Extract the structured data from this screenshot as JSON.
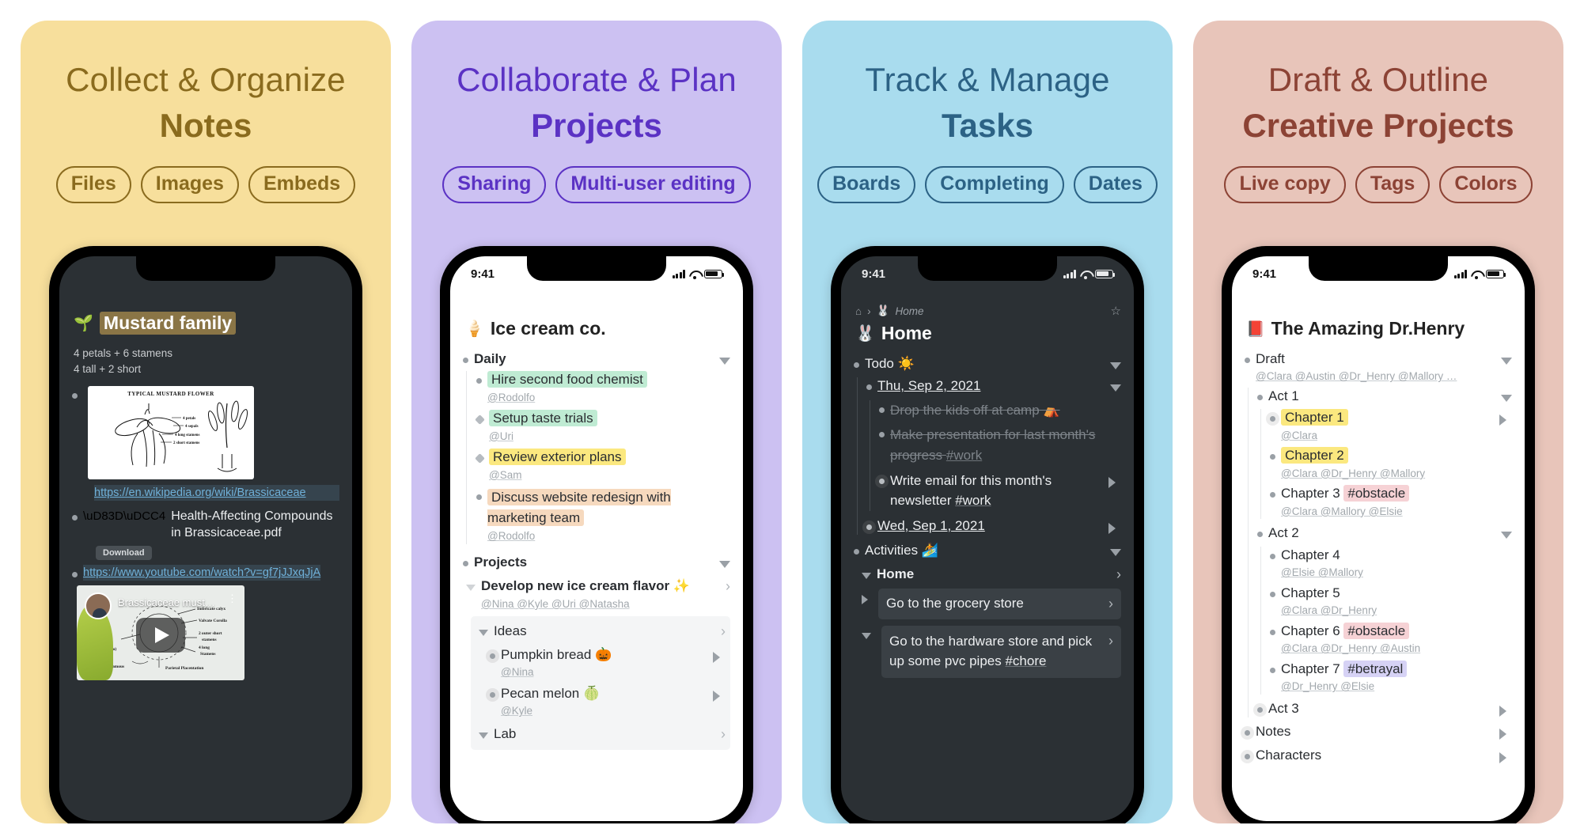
{
  "panels": [
    {
      "bg": "#F7DF9C",
      "accent": "#8A6B1E",
      "headline": "Collect & Organize",
      "subline": "Notes",
      "pills": [
        "Files",
        "Images",
        "Embeds"
      ],
      "phone": {
        "theme": "dark",
        "status": {
          "time": "",
          "shown": false
        },
        "doc": {
          "emoji": "🌱",
          "title": "Mustard family",
          "note_line1": "4 petals + 6 stamens",
          "note_line2": "4 tall + 2 short",
          "image_caption": "TYPICAL MUSTARD FLOWER",
          "image_labels": [
            "4 petals",
            "4 sepals",
            "4 long stamens",
            "2 short stamens"
          ],
          "wiki_link": "https://en.wikipedia.org/wiki/Brassicaceae",
          "pdf_name": "Health-Affecting Compounds in Brassicaceae.pdf",
          "download_label": "Download",
          "youtube_link": "https://www.youtube.com/watch?v=gf7jJJxqJjA",
          "video_title": "Brassicaceae must…",
          "video_labels": [
            "Imbricate calyx",
            "Valvate Corolla",
            "2 outer short stamens",
            "4 long Stamens",
            "Parietal Placentation",
            "Repum (false septum)",
            "Tetradynamous"
          ]
        }
      }
    },
    {
      "bg": "#CCC1F2",
      "accent": "#5B32C4",
      "headline": "Collaborate & Plan",
      "subline": "Projects",
      "pills": [
        "Sharing",
        "Multi-user editing"
      ],
      "phone": {
        "theme": "light",
        "status": {
          "time": "9:41",
          "shown": true
        },
        "doc": {
          "emoji": "🍦",
          "title": "Ice cream co.",
          "sections": [
            {
              "label": "Daily",
              "items": [
                {
                  "text": "Hire second food chemist",
                  "mention": "@Rodolfo",
                  "hl": "hl-green",
                  "bullet": "dot"
                },
                {
                  "text": "Setup taste trials",
                  "mention": "@Uri",
                  "hl": "hl-green",
                  "bullet": "dia"
                },
                {
                  "text": "Review exterior plans",
                  "mention": "@Sam",
                  "hl": "hl-yellow",
                  "bullet": "dia"
                },
                {
                  "text": "Discuss website redesign with marketing team",
                  "mention": "@Rodolfo",
                  "hl": "hl-orange",
                  "bullet": "dot"
                }
              ]
            },
            {
              "label": "Projects",
              "project": {
                "title": "Develop new ice cream flavor ✨",
                "mentions": "@Nina @Kyle @Uri @Natasha",
                "group_label": "Ideas",
                "ideas": [
                  {
                    "text": "Pumpkin bread 🎃",
                    "mention": "@Nina"
                  },
                  {
                    "text": "Pecan melon 🍈",
                    "mention": "@Kyle"
                  }
                ],
                "next_group": "Lab"
              }
            }
          ]
        }
      }
    },
    {
      "bg": "#A9DCEE",
      "accent": "#2C6285",
      "headline": "Track & Manage",
      "subline": "Tasks",
      "pills": [
        "Boards",
        "Completing",
        "Dates"
      ],
      "phone": {
        "theme": "dark",
        "status": {
          "time": "9:41",
          "shown": true
        },
        "doc": {
          "breadcrumb_home_icon": "home-icon",
          "breadcrumb_emoji": "🐰",
          "breadcrumb_label": "Home",
          "emoji": "🐰",
          "title": "Home",
          "sections": [
            {
              "label": "Todo ☀️",
              "date_group": "Thu, Sep 2, 2021",
              "items": [
                {
                  "text": "Drop the kids off at camp ⛺",
                  "done": true
                },
                {
                  "text": "Make presentation for last month's progress ",
                  "tag": "#work",
                  "done": true
                },
                {
                  "text": "Write email for this month's newsletter ",
                  "tag": "#work",
                  "done": false
                }
              ],
              "next_date": "Wed, Sep 1, 2021"
            },
            {
              "label": "Activities 🏄",
              "group": "Home",
              "cards": [
                {
                  "text": "Go to the grocery store",
                  "tag": ""
                },
                {
                  "text": "Go to the hardware store and pick up some pvc pipes ",
                  "tag": "#chore"
                }
              ]
            }
          ]
        }
      }
    },
    {
      "bg": "#E8C5BA",
      "accent": "#8C4335",
      "headline": "Draft & Outline",
      "subline": "Creative Projects",
      "pills": [
        "Live copy",
        "Tags",
        "Colors"
      ],
      "phone": {
        "theme": "light",
        "status": {
          "time": "9:41",
          "shown": true
        },
        "doc": {
          "emoji": "📕",
          "title": "The Amazing Dr.Henry",
          "draft_label": "Draft",
          "draft_mentions": "@Clara @Austin @Dr_Henry @Mallory …",
          "acts": [
            {
              "label": "Act 1",
              "chapters": [
                {
                  "text": "Chapter 1",
                  "hl": "hl-yellow",
                  "mentions": "@Clara",
                  "arrow": true,
                  "ring": true
                },
                {
                  "text": "Chapter 2",
                  "hl": "hl-yellow",
                  "mentions": "@Clara @Dr_Henry @Mallory"
                },
                {
                  "text": "Chapter 3 ",
                  "tag": "#obstacle",
                  "tag_hl": "hl-pink",
                  "mentions": "@Clara @Mallory @Elsie"
                }
              ]
            },
            {
              "label": "Act 2",
              "chapters": [
                {
                  "text": "Chapter 4",
                  "mentions": "@Elsie @Mallory"
                },
                {
                  "text": "Chapter 5",
                  "mentions": "@Clara @Dr_Henry"
                },
                {
                  "text": "Chapter 6 ",
                  "tag": "#obstacle",
                  "tag_hl": "hl-pink",
                  "mentions": "@Clara @Dr_Henry @Austin"
                },
                {
                  "text": "Chapter 7 ",
                  "tag": "#betrayal",
                  "tag_hl": "hl-purple",
                  "mentions": "@Dr_Henry @Elsie"
                }
              ]
            }
          ],
          "tail": [
            "Act 3",
            "Notes",
            "Characters"
          ]
        }
      }
    }
  ]
}
